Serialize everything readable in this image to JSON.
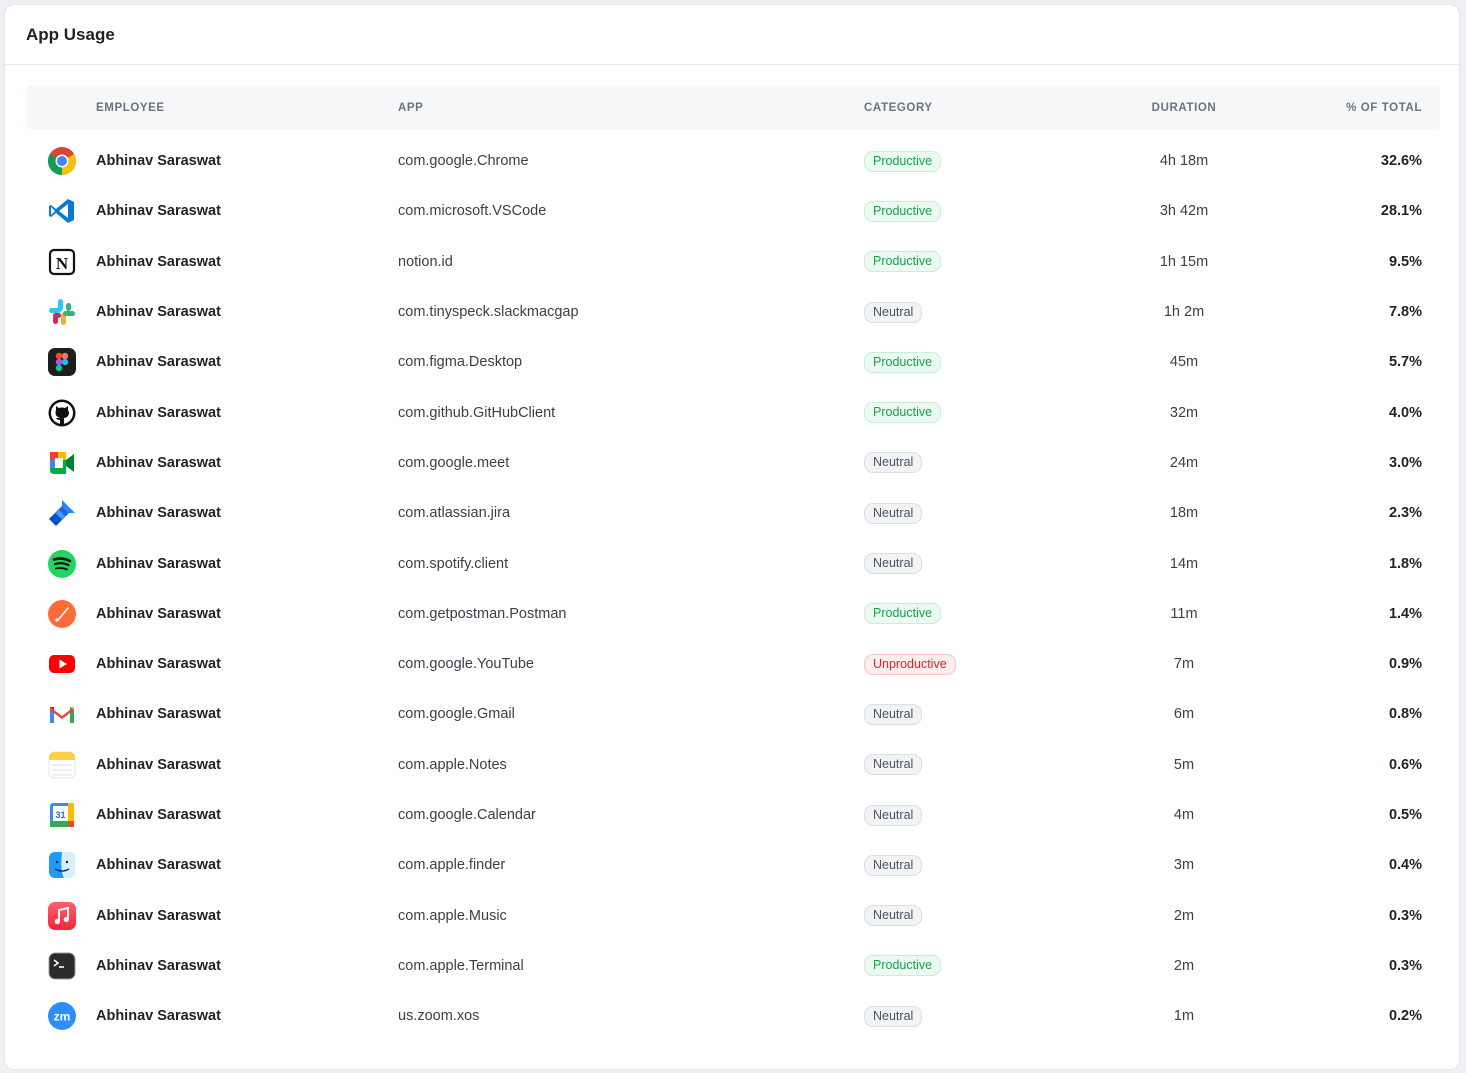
{
  "card": {
    "title": "App Usage"
  },
  "table": {
    "headers": {
      "employee": "EMPLOYEE",
      "app": "APP",
      "category": "CATEGORY",
      "duration": "DURATION",
      "pct": "% OF TOTAL"
    },
    "rows": [
      {
        "icon": "chrome-icon",
        "employee": "Abhinav Saraswat",
        "app": "com.google.Chrome",
        "category": "Productive",
        "duration": "4h 18m",
        "pct": "32.6%"
      },
      {
        "icon": "vscode-icon",
        "employee": "Abhinav Saraswat",
        "app": "com.microsoft.VSCode",
        "category": "Productive",
        "duration": "3h 42m",
        "pct": "28.1%"
      },
      {
        "icon": "notion-icon",
        "employee": "Abhinav Saraswat",
        "app": "notion.id",
        "category": "Productive",
        "duration": "1h 15m",
        "pct": "9.5%"
      },
      {
        "icon": "slack-icon",
        "employee": "Abhinav Saraswat",
        "app": "com.tinyspeck.slackmacgap",
        "category": "Neutral",
        "duration": "1h 2m",
        "pct": "7.8%"
      },
      {
        "icon": "figma-icon",
        "employee": "Abhinav Saraswat",
        "app": "com.figma.Desktop",
        "category": "Productive",
        "duration": "45m",
        "pct": "5.7%"
      },
      {
        "icon": "github-icon",
        "employee": "Abhinav Saraswat",
        "app": "com.github.GitHubClient",
        "category": "Productive",
        "duration": "32m",
        "pct": "4.0%"
      },
      {
        "icon": "google-meet-icon",
        "employee": "Abhinav Saraswat",
        "app": "com.google.meet",
        "category": "Neutral",
        "duration": "24m",
        "pct": "3.0%"
      },
      {
        "icon": "jira-icon",
        "employee": "Abhinav Saraswat",
        "app": "com.atlassian.jira",
        "category": "Neutral",
        "duration": "18m",
        "pct": "2.3%"
      },
      {
        "icon": "spotify-icon",
        "employee": "Abhinav Saraswat",
        "app": "com.spotify.client",
        "category": "Neutral",
        "duration": "14m",
        "pct": "1.8%"
      },
      {
        "icon": "postman-icon",
        "employee": "Abhinav Saraswat",
        "app": "com.getpostman.Postman",
        "category": "Productive",
        "duration": "11m",
        "pct": "1.4%"
      },
      {
        "icon": "youtube-icon",
        "employee": "Abhinav Saraswat",
        "app": "com.google.YouTube",
        "category": "Unproductive",
        "duration": "7m",
        "pct": "0.9%"
      },
      {
        "icon": "gmail-icon",
        "employee": "Abhinav Saraswat",
        "app": "com.google.Gmail",
        "category": "Neutral",
        "duration": "6m",
        "pct": "0.8%"
      },
      {
        "icon": "notes-icon",
        "employee": "Abhinav Saraswat",
        "app": "com.apple.Notes",
        "category": "Neutral",
        "duration": "5m",
        "pct": "0.6%"
      },
      {
        "icon": "google-calendar-icon",
        "employee": "Abhinav Saraswat",
        "app": "com.google.Calendar",
        "category": "Neutral",
        "duration": "4m",
        "pct": "0.5%"
      },
      {
        "icon": "finder-icon",
        "employee": "Abhinav Saraswat",
        "app": "com.apple.finder",
        "category": "Neutral",
        "duration": "3m",
        "pct": "0.4%"
      },
      {
        "icon": "apple-music-icon",
        "employee": "Abhinav Saraswat",
        "app": "com.apple.Music",
        "category": "Neutral",
        "duration": "2m",
        "pct": "0.3%"
      },
      {
        "icon": "terminal-icon",
        "employee": "Abhinav Saraswat",
        "app": "com.apple.Terminal",
        "category": "Productive",
        "duration": "2m",
        "pct": "0.3%"
      },
      {
        "icon": "zoom-icon",
        "employee": "Abhinav Saraswat",
        "app": "us.zoom.xos",
        "category": "Neutral",
        "duration": "1m",
        "pct": "0.2%"
      }
    ]
  },
  "icon_text": {
    "notion": "N",
    "calendar": "31",
    "zoom": "zm"
  },
  "colors": {
    "productive": "#15a34a",
    "neutral": "#4b5563",
    "unproductive": "#dc2626"
  }
}
